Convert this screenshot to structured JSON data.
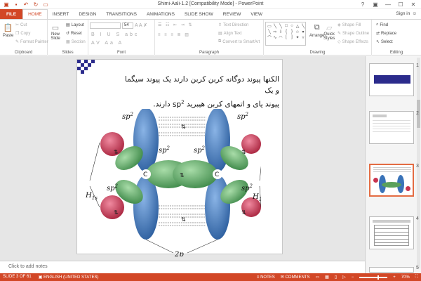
{
  "window": {
    "title": "Shimi-Aali-1.2 [Compatibility Mode] - PowerPoint",
    "controls": [
      "?",
      "▣",
      "—",
      "☐",
      "✕"
    ]
  },
  "tabs": [
    {
      "label": "FILE"
    },
    {
      "label": "HOME"
    },
    {
      "label": "INSERT"
    },
    {
      "label": "DESIGN"
    },
    {
      "label": "TRANSITIONS"
    },
    {
      "label": "ANIMATIONS"
    },
    {
      "label": "SLIDE SHOW"
    },
    {
      "label": "REVIEW"
    },
    {
      "label": "VIEW"
    }
  ],
  "signin": "Sign in",
  "ribbon": {
    "clipboard": {
      "paste": "Paste",
      "cut": "Cut",
      "copy": "Copy",
      "format_painter": "Format Painter",
      "label": "Clipboard"
    },
    "slides": {
      "new_slide": "New",
      "new_slide2": "Slide",
      "layout": "Layout",
      "reset": "Reset",
      "section": "Section",
      "label": "Slides"
    },
    "font": {
      "size": "54",
      "label": "Font"
    },
    "paragraph": {
      "text_direction": "Text Direction",
      "align_text": "Align Text",
      "smartart": "Convert to SmartArt",
      "label": "Paragraph"
    },
    "drawing": {
      "arrange": "Arrange",
      "quick_styles": "Quick",
      "quick_styles2": "Styles",
      "shape_fill": "Shape Fill",
      "shape_outline": "Shape Outline",
      "shape_effects": "Shape Effects",
      "label": "Drawing"
    },
    "editing": {
      "find": "Find",
      "replace": "Replace",
      "select": "Select",
      "label": "Editing"
    }
  },
  "slide": {
    "line1": "الکنها پیوند دوگانه کربن کربن دارند یک پیوند سیگما و یک",
    "line2a": "پیوند پای و اتمهای کربن هیبرید",
    "sp": "sp",
    "sup": "2",
    "line2b": " دارند.",
    "labels": {
      "sp2": "sp",
      "sup2": "2",
      "c": "C",
      "h": "H",
      "h_sub": "1s",
      "p": "2p"
    }
  },
  "notes_placeholder": "Click to add notes",
  "thumbnails": [
    {
      "num": "1"
    },
    {
      "num": "2"
    },
    {
      "num": "3"
    },
    {
      "num": "4"
    },
    {
      "num": "5"
    }
  ],
  "status": {
    "slide": "SLIDE 3 OF 61",
    "lang": "ENGLISH (UNITED STATES)",
    "notes": "NOTES",
    "comments": "COMMENTS",
    "zoom": "70%"
  },
  "colors": {
    "accent": "#d24726",
    "blue_lobe": "#3a73b8",
    "red_lobe": "#c8344f",
    "green_lobe": "#5aa05a"
  }
}
